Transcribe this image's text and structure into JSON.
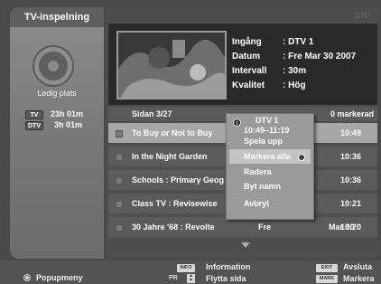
{
  "left": {
    "title": "TV-inspelning",
    "free_space_label": "Ledig plats",
    "storage": [
      {
        "badge": "TV",
        "time": "23h 01m"
      },
      {
        "badge": "DTV",
        "time": "3h 01m"
      }
    ]
  },
  "logo": "DTV",
  "info": {
    "labels": [
      "Ingång",
      "Datum",
      "Intervall",
      "Kvalitet"
    ],
    "values": [
      ": DTV 1",
      ": Fre Mar 30 2007",
      ": 30m",
      ": Hög"
    ]
  },
  "list": {
    "page": "Sidan  3/27",
    "marked": "0 markerad",
    "rows": [
      {
        "name": "To Buy or Not to Buy",
        "channel": "",
        "date": "",
        "time": "10:49",
        "selected": true
      },
      {
        "name": "In the Night Garden",
        "channel": "",
        "date": "",
        "time": "10:36",
        "selected": false
      },
      {
        "name": "Schools : Primary Geog",
        "channel": "",
        "date": "",
        "time": "10:36",
        "selected": false
      },
      {
        "name": "Class TV : Revisewise",
        "channel": "",
        "date": "",
        "time": "10:21",
        "selected": false
      },
      {
        "name": "30 Jahre '68 : Revolte",
        "channel": "Fre",
        "date": "Mar 30",
        "time": "10:20",
        "selected": false
      }
    ]
  },
  "popup": {
    "info_icon": "i",
    "channel": "DTV 1",
    "time": "10:49–11:19",
    "items": [
      "Spela upp",
      "Markera alla",
      "Radera",
      "Byt namn",
      "Avbryt"
    ],
    "active_index": 1
  },
  "bottom": {
    "popup_menu": "Popupmeny",
    "info_key": "INFO",
    "info_label": "Information",
    "pr_key": "PR",
    "pr_label": "Flytta sida",
    "exit_key": "EXIT",
    "exit_label": "Avsluta",
    "mark_key": "MARK",
    "mark_label": "Markera"
  }
}
